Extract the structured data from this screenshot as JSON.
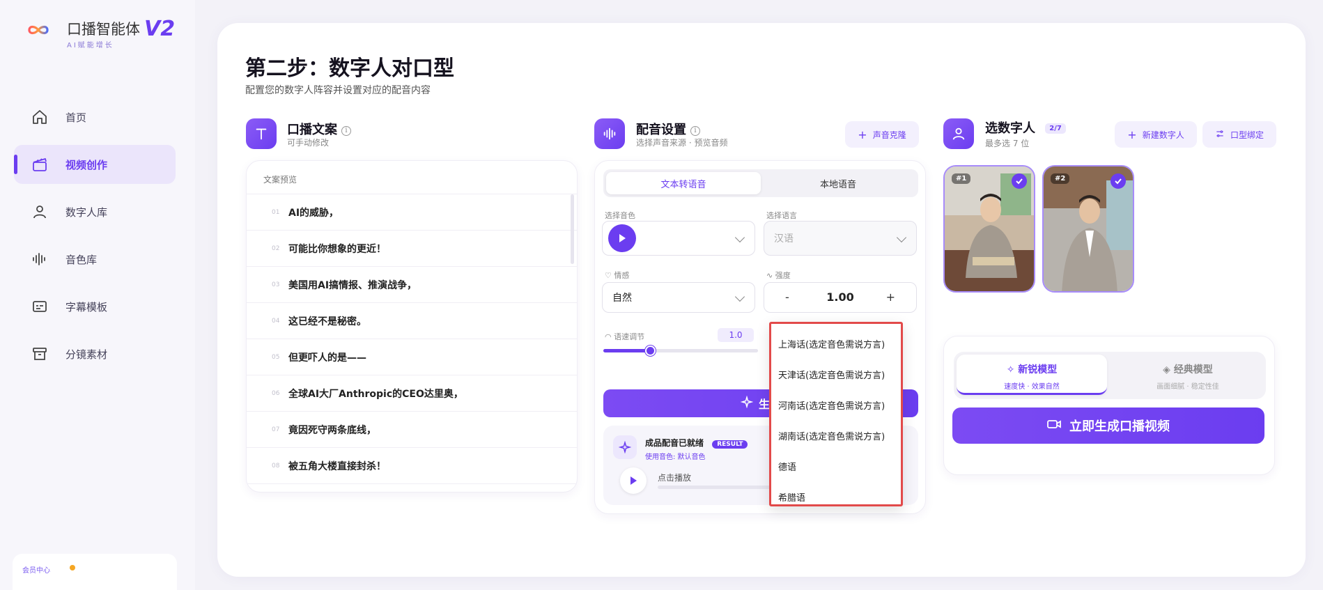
{
  "brand": {
    "title": "口播智能体",
    "version": "V2",
    "subtitle": "AI赋能增长"
  },
  "nav": [
    {
      "label": "首页",
      "icon": "home-icon",
      "active": false
    },
    {
      "label": "视频创作",
      "icon": "clapperboard-icon",
      "active": true
    },
    {
      "label": "数字人库",
      "icon": "user-icon",
      "active": false
    },
    {
      "label": "音色库",
      "icon": "audio-wave-icon",
      "active": false
    },
    {
      "label": "字幕模板",
      "icon": "subtitle-icon",
      "active": false
    },
    {
      "label": "分镜素材",
      "icon": "archive-box-icon",
      "active": false
    }
  ],
  "member": {
    "label": "会员中心"
  },
  "page": {
    "title": "第二步：数字人对口型",
    "subtitle": "配置您的数字人阵容并设置对应的配音内容"
  },
  "script": {
    "title": "口播文案",
    "subtitle": "可手动修改",
    "preview_label": "文案预览",
    "lines": [
      {
        "num": "01",
        "text": "AI的威胁，"
      },
      {
        "num": "02",
        "text": "可能比你想象的更近！"
      },
      {
        "num": "03",
        "text": "美国用AI搞情报、推演战争，"
      },
      {
        "num": "04",
        "text": "这已经不是秘密。"
      },
      {
        "num": "05",
        "text": "但更吓人的是——"
      },
      {
        "num": "06",
        "text": "全球AI大厂Anthropic的CEO达里奥，"
      },
      {
        "num": "07",
        "text": "竟因死守两条底线，"
      },
      {
        "num": "08",
        "text": "被五角大楼直接封杀！"
      }
    ]
  },
  "dubbing": {
    "title": "配音设置",
    "subtitle": "选择声音来源 · 预览音频",
    "clone_button": "声音克隆",
    "tabs": [
      "文本转语音",
      "本地语音"
    ],
    "active_tab": 0,
    "voice_label": "选择音色",
    "language_label": "选择语言",
    "language_value": "汉语",
    "emotion_label": "情感",
    "emotion_value": "自然",
    "intensity_label": "强度",
    "intensity_value": "1.00",
    "minus": "-",
    "plus": "+",
    "speed_label": "语速调节",
    "speed_value": "1.0",
    "speed_level": 0.3,
    "generate_label": "生成",
    "result_title": "成品配音已就绪",
    "result_badge": "RESULT",
    "result_voice": "使用音色: 默认音色",
    "result_play": "点击播放"
  },
  "language_options": [
    "上海话(选定音色需说方言)",
    "天津话(选定音色需说方言)",
    "河南话(选定音色需说方言)",
    "湖南话(选定音色需说方言)",
    "德语",
    "希腊语"
  ],
  "digital_human": {
    "title": "选数字人",
    "count_badge": "2/7",
    "subtitle": "最多选 7 位",
    "new_button": "新建数字人",
    "bind_button": "口型绑定",
    "selected": [
      {
        "tag": "#1"
      },
      {
        "tag": "#2"
      }
    ]
  },
  "model": {
    "options": [
      {
        "name": "新锐模型",
        "desc": "速度快 · 效果自然",
        "active": true
      },
      {
        "name": "经典模型",
        "desc": "画面细腻 · 稳定性佳",
        "active": false
      }
    ],
    "generate_button": "立即生成口播视频"
  },
  "colors": {
    "accent": "#6b3df0",
    "accent_light": "#ebe5fb",
    "dropdown_border": "#e24a4a"
  }
}
